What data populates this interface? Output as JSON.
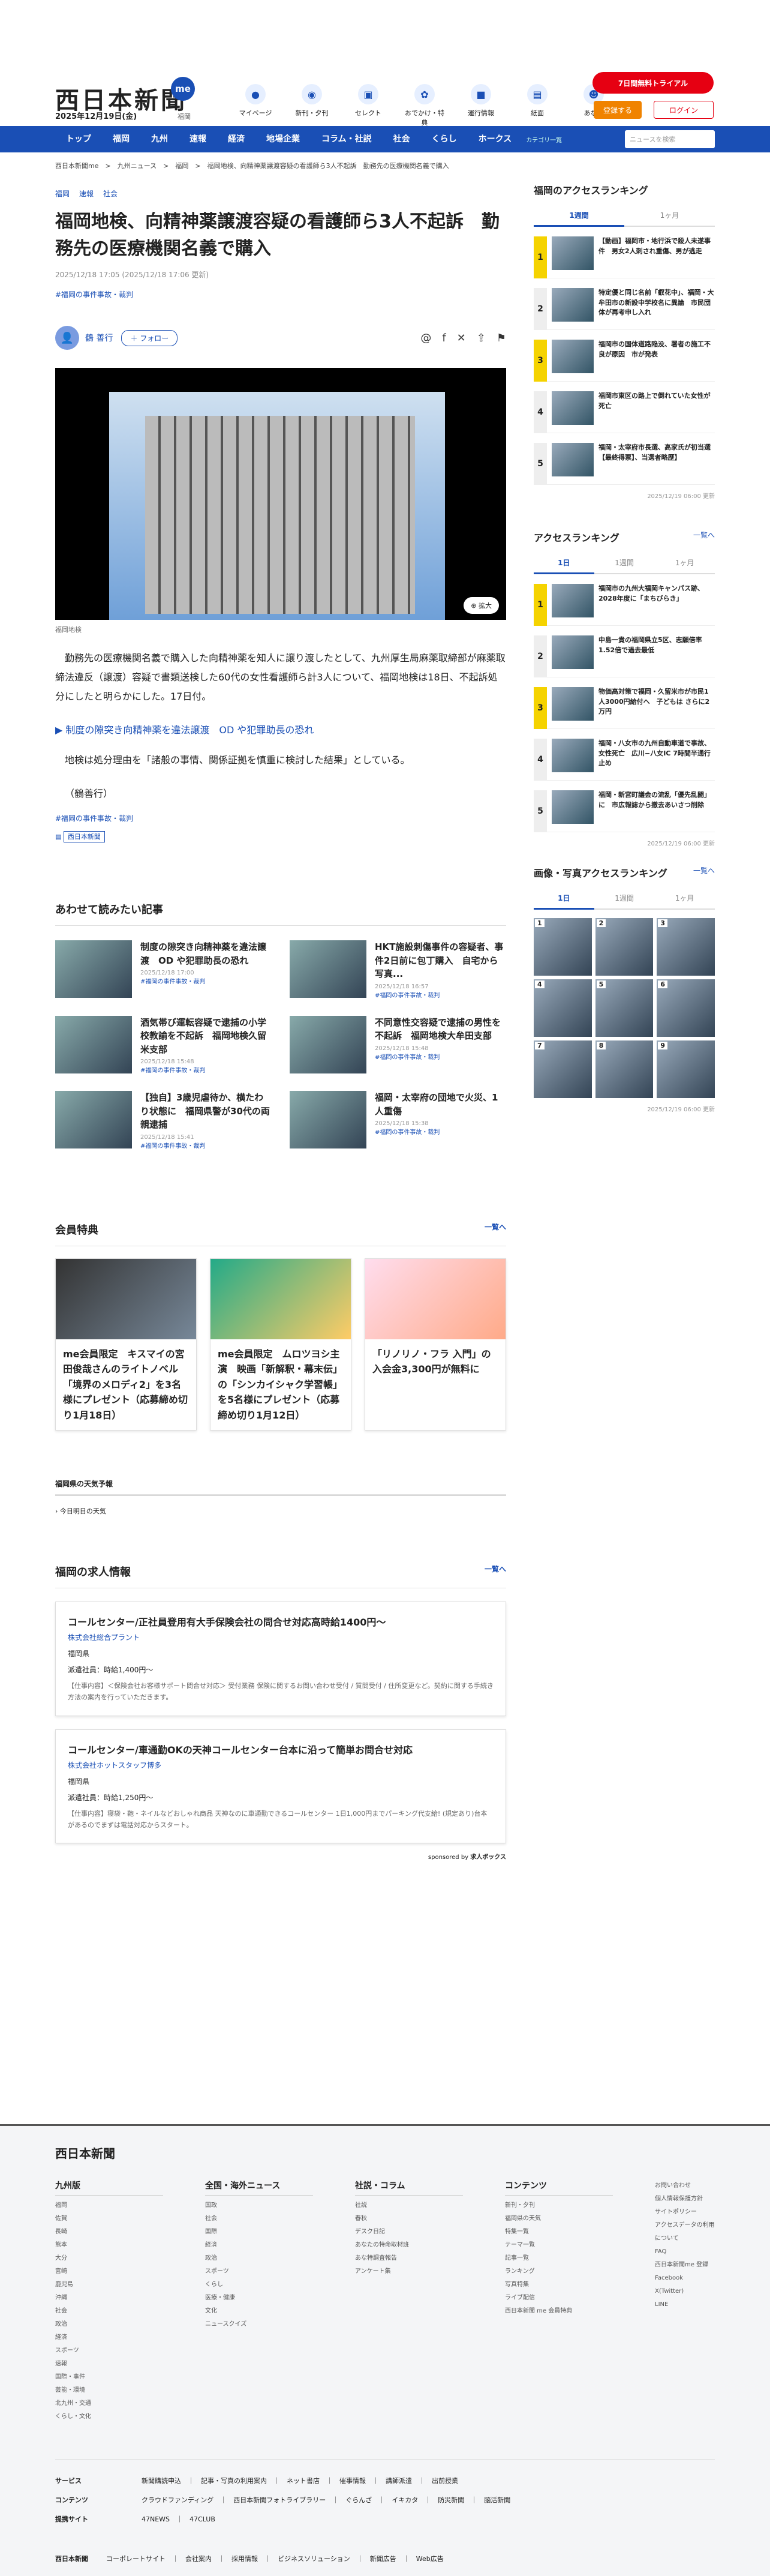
{
  "header": {
    "brand": "西日本新聞",
    "brand_me": "me",
    "date": "2025年12月19日(金)",
    "pref": "福岡",
    "nav": [
      {
        "label": "マイページ",
        "icon": "me-icon"
      },
      {
        "label": "新刊・夕刊",
        "icon": "paper-icon"
      },
      {
        "label": "セレクト",
        "icon": "select-icon"
      },
      {
        "label": "おでかけ・特典",
        "icon": "ticket-icon"
      },
      {
        "label": "運行情報",
        "icon": "bus-icon"
      },
      {
        "label": "紙面",
        "icon": "news-icon"
      },
      {
        "label": "あな特",
        "icon": "mascot-icon"
      }
    ],
    "trial": "7日間無料トライアル",
    "register": "登録する",
    "login": "ログイン"
  },
  "gnav": {
    "items": [
      "トップ",
      "福岡",
      "九州",
      "速報",
      "経済",
      "地場企業",
      "コラム・社説",
      "社会",
      "くらし",
      "ホークス"
    ],
    "cat": "カテゴリ一覧",
    "search_placeholder": "ニュースを検索"
  },
  "breadcrumb": "西日本新聞me　>　九州ニュース　>　福岡　>　福岡地検、向精神薬譲渡容疑の看護師ら3人不起訴　勤務先の医療機関名義で購入",
  "article": {
    "tags": [
      "福岡",
      "速報",
      "社会"
    ],
    "title": "福岡地検、向精神薬譲渡容疑の看護師ら3人不起訴　勤務先の医療機関名義で購入",
    "pub": "2025/12/18 17:05 (2025/12/18 17:06 更新)",
    "hashtag": "#福岡の事件事故・裁判",
    "author": "鶴 善行",
    "follow": "＋ フォロー",
    "zoom": "拡大",
    "caption": "福岡地検",
    "p1": "勤務先の医療機関名義で購入した向精神薬を知人に譲り渡したとして、九州厚生局麻薬取締部が麻薬取締法違反（譲渡）容疑で書類送検した60代の女性看護師ら計3人について、福岡地検は18日、不起訴処分にしたと明らかにした。17日付。",
    "related": "制度の隙突き向精神薬を違法譲渡　OD や犯罪助長の恐れ",
    "p2": "地検は処分理由を「諸般の事情、関係証拠を慎重に検討した結果」としている。",
    "p3": "（鶴善行）",
    "hashtag2": "#福岡の事件事故・裁判",
    "source": "西日本新聞"
  },
  "related": {
    "title": "あわせて読みたい記事",
    "items": [
      {
        "t": "制度の隙突き向精神薬を違法譲渡　OD や犯罪助長の恐れ",
        "d": "2025/12/18 17:00",
        "c": "#福岡の事件事故・裁判"
      },
      {
        "t": "HKT施設刺傷事件の容疑者、事件2日前に包丁購入　自宅から写真...",
        "d": "2025/12/18 16:57",
        "c": "#福岡の事件事故・裁判"
      },
      {
        "t": "酒気帯び運転容疑で逮捕の小学校教諭を不起訴　福岡地検久留米支部",
        "d": "2025/12/18 15:48",
        "c": "#福岡の事件事故・裁判"
      },
      {
        "t": "不同意性交容疑で逮捕の男性を不起訴　福岡地検大牟田支部",
        "d": "2025/12/18 15:48",
        "c": "#福岡の事件事故・裁判"
      },
      {
        "t": "【独自】3歳児虐待か、横たわり状態に　福岡県警が30代の両親逮捕",
        "d": "2025/12/18 15:41",
        "c": "#福岡の事件事故・裁判"
      },
      {
        "t": "福岡・太宰府の団地で火災、1人重傷",
        "d": "2025/12/18 15:38",
        "c": "#福岡の事件事故・裁判"
      }
    ]
  },
  "member": {
    "title": "会員特典",
    "more": "一覧へ",
    "items": [
      "me会員限定　キスマイの宮田俊哉さんのライトノベル「境界のメロディ2」を3名様にプレゼント（応募締め切り1月18日）",
      "me会員限定　ムロツヨシ主演　映画「新解釈・幕末伝」の「シンカイシャク学習帳」を5名様にプレゼント（応募締め切り1月12日）",
      "「リノリノ・フラ 入門」の入会金3,300円が無料に"
    ]
  },
  "weather": {
    "title": "福岡県の天気予報",
    "sub": "今日明日の天気"
  },
  "jobs": {
    "title": "福岡の求人情報",
    "more": "一覧へ",
    "sponsor": "sponsored by",
    "sponsor_name": "求人ボックス",
    "items": [
      {
        "t": "コールセンター/正社員登用有大手保険会社の問合せ対応高時給1400円〜",
        "co": "株式会社総合プラント",
        "loc": "福岡県",
        "pay": "派遣社員：時給1,400円〜",
        "desc": "【仕事内容】＜保険会社お客様サポート問合せ対応＞ 受付業務 保険に関するお問い合わせ受付 / 質問受付 / 住所変更など。契約に関する手続き方法の案内を行っていただきます。"
      },
      {
        "t": "コールセンター/車通勤OKの天神コールセンター台本に沿って簡単お問合せ対応",
        "co": "株式会社ホットスタッフ博多",
        "loc": "福岡県",
        "pay": "派遣社員：時給1,250円〜",
        "desc": "【仕事内容】寝袋・鞄・ネイルなどおしゃれ商品 天神なのに車通勤できるコールセンター 1日1,000円までパーキング代支給! (規定あり)台本があるのでまずは電話対応からスタート。"
      }
    ]
  },
  "sidebar": {
    "rank1": {
      "title": "福岡のアクセスランキング",
      "tabs": [
        "1週間",
        "1ヶ月"
      ],
      "items": [
        "【動画】福岡市・地行浜で殺人未遂事件　男女2人刺され重傷、男が逃走",
        "特定優と同じ名前「叡花中」、福岡・大牟田市の新設中学校名に異論　市民団体が再考申し入れ",
        "福岡市の国体道路陥没、署者の施工不良が原因　市が発表",
        "福岡市東区の路上で倒れていた女性が死亡",
        "福岡・太宰府市長選、高家氏が初当選【最終得票】、当選者略歴】"
      ],
      "upd": "2025/12/19 06:00 更新"
    },
    "rank2": {
      "title": "アクセスランキング",
      "more": "一覧へ",
      "tabs": [
        "1日",
        "1週間",
        "1ヶ月"
      ],
      "items": [
        "福岡市の九州大福岡キャンパス跡、2028年度に「まちびらき」",
        "中島一貴の福岡県立5区、志願倍率1.52倍で過去最低",
        "物価高対策で福岡・久留米市が市民1人3000円給付へ　子どもは さらに2万円",
        "福岡・八女市の九州自動車道で事故、女性死亡　広川−八女IC 7時間半通行止め",
        "福岡・新宮町議会の流乱「優先乱闘」に　市広報誌から撤去あいさつ削除"
      ],
      "upd": "2025/12/19 06:00 更新"
    },
    "rank3": {
      "title": "画像・写真アクセスランキング",
      "more": "一覧へ",
      "tabs": [
        "1日",
        "1週間",
        "1ヶ月"
      ],
      "upd": "2025/12/19 06:00 更新"
    }
  },
  "footer": {
    "brand": "西日本新聞",
    "cols": [
      {
        "h": "九州版",
        "l": [
          "福岡",
          "佐賀",
          "長崎",
          "熊本",
          "大分",
          "宮崎",
          "鹿児島",
          "沖縄",
          "社会",
          "政治",
          "経済",
          "スポーツ",
          "速報",
          "国際・事件",
          "芸能・環境",
          "北九州・交通",
          "くらし・文化"
        ]
      },
      {
        "h": "全国・海外ニュース",
        "l": [
          "国政",
          "社会",
          "国際",
          "経済",
          "政治",
          "スポーツ",
          "くらし",
          "医療・健康",
          "文化",
          "ニュースクイズ"
        ]
      },
      {
        "h": "社説・コラム",
        "l": [
          "社説",
          "春秋",
          "デスク日記",
          "あなたの特命取材班",
          "あな特調査報告",
          "アンケート集"
        ]
      },
      {
        "h": "コンテンツ",
        "l": [
          "新刊・夕刊",
          "福岡県の天気",
          "特集一覧",
          "テーマ一覧",
          "記事一覧",
          "ランキング",
          "写真特集",
          "ライブ配信",
          "西日本新聞 me 会員特典"
        ]
      }
    ],
    "side": [
      "お問い合わせ",
      "個人情報保護方針",
      "サイトポリシー",
      "アクセスデータの利用について",
      "FAQ",
      "西日本新聞me 登録",
      "Facebook",
      "X(Twitter)",
      "LINE"
    ],
    "rows": [
      {
        "h": "サービス",
        "l": "新聞購読申込　｜　記事・写真の利用案内　｜　ネット書店　｜　催事情報　｜　講師派遣　｜　出前授業"
      },
      {
        "h": "コンテンツ",
        "l": "クラウドファンディング　｜　西日本新聞フォトライブラリー　｜　ぐらんざ　｜　イキカタ　｜　防災新聞　｜　脳活新聞"
      },
      {
        "h": "提携サイト",
        "l": "47NEWS　｜　47CLUB"
      }
    ],
    "bottom": "コーポレートサイト　｜　会社案内　｜　採用情報　｜　ビジネスソリューション　｜　新聞広告　｜　Web広告"
  }
}
